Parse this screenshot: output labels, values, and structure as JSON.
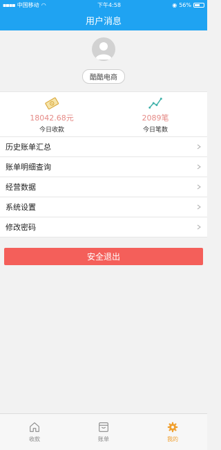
{
  "status": {
    "carrier": "中国移动",
    "time": "下午4:58",
    "battery": "56%",
    "battery_level": 0.56
  },
  "header": {
    "title": "用户消息"
  },
  "profile": {
    "shop_name": "酷酷电商"
  },
  "stats": [
    {
      "value": "18042.68元",
      "label": "今日收款",
      "icon": "money-icon"
    },
    {
      "value": "2089笔",
      "label": "今日笔数",
      "icon": "trend-chart-icon"
    }
  ],
  "menu": [
    {
      "label": "历史账单汇总"
    },
    {
      "label": "账单明细查询"
    },
    {
      "label": "经营数据"
    },
    {
      "label": "系统设置"
    },
    {
      "label": "修改密码"
    }
  ],
  "logout_label": "安全退出",
  "tabs": [
    {
      "label": "收款",
      "icon": "home-icon"
    },
    {
      "label": "账单",
      "icon": "bill-icon"
    },
    {
      "label": "我的",
      "icon": "gear-icon"
    }
  ],
  "colors": {
    "primary": "#1fa3f2",
    "accent_value": "#e58a86",
    "logout": "#f45f5a",
    "tab_active": "#f0a030"
  }
}
